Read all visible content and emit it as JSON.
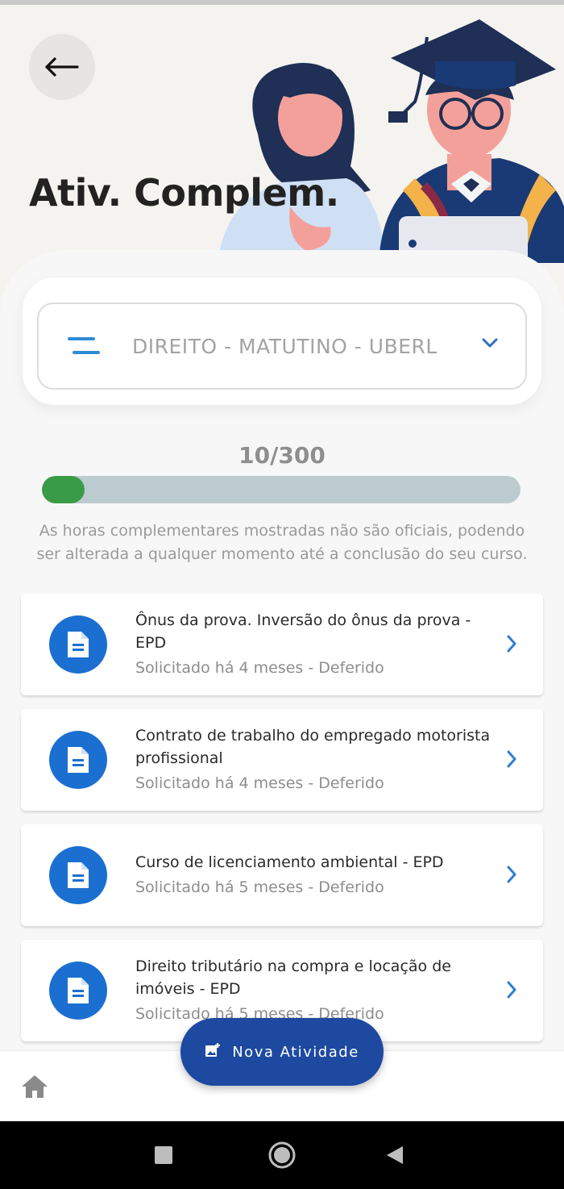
{
  "header": {
    "title": "Ativ. Complem."
  },
  "course_selector": {
    "value": "DIREITO - MATUTINO - UBERL"
  },
  "progress": {
    "label": "10/300",
    "current": 10,
    "total": 300
  },
  "disclaimer": "As horas complementares mostradas não são oficiais, podendo ser alterada a qualquer momento até a conclusão do seu curso.",
  "activities": [
    {
      "title": "Ônus da prova. Inversão do ônus da prova - EPD",
      "status": "Solicitado há 4 meses - Deferido"
    },
    {
      "title": "Contrato de trabalho do empregado motorista profissional",
      "status": "Solicitado há 4 meses - Deferido"
    },
    {
      "title": "Curso de licenciamento ambiental - EPD",
      "status": "Solicitado há 5 meses - Deferido"
    },
    {
      "title": "Direito tributário na compra e locação de imóveis - EPD",
      "status": "Solicitado há 5 meses - Deferido"
    }
  ],
  "fab": {
    "label": "Nova Atividade"
  },
  "icons": {
    "back": "arrow-left-icon",
    "course": "filter-lines-icon",
    "dropdown": "chevron-down-icon",
    "document": "document-icon",
    "chevron": "chevron-right-icon",
    "fab": "add-photo-icon",
    "home": "home-icon"
  },
  "colors": {
    "accent_blue": "#1b6fd0",
    "fab_blue": "#1d4aa0",
    "progress_green": "#3a9b46",
    "progress_track": "#bccbcf"
  }
}
